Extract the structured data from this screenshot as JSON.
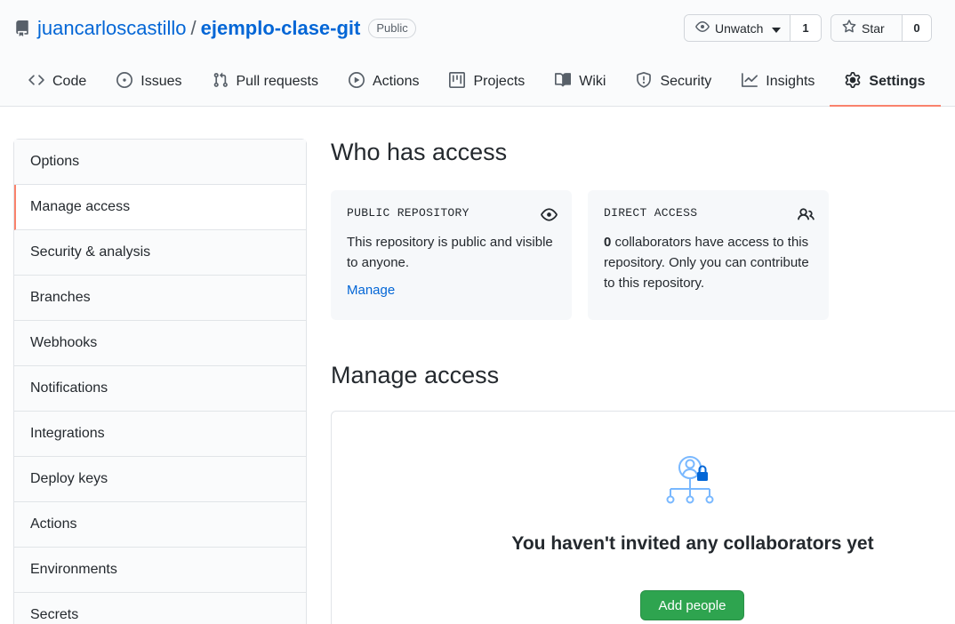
{
  "repo": {
    "owner": "juancarloscastillo",
    "separator": "/",
    "name": "ejemplo-clase-git",
    "visibility": "Public"
  },
  "header_actions": {
    "watch_label": "Unwatch",
    "watch_count": "1",
    "star_label": "Star",
    "star_count": "0"
  },
  "tabs": [
    {
      "label": "Code",
      "icon": "code-icon"
    },
    {
      "label": "Issues",
      "icon": "issue-icon"
    },
    {
      "label": "Pull requests",
      "icon": "pull-request-icon"
    },
    {
      "label": "Actions",
      "icon": "play-icon"
    },
    {
      "label": "Projects",
      "icon": "project-icon"
    },
    {
      "label": "Wiki",
      "icon": "book-icon"
    },
    {
      "label": "Security",
      "icon": "shield-icon"
    },
    {
      "label": "Insights",
      "icon": "graph-icon"
    },
    {
      "label": "Settings",
      "icon": "gear-icon",
      "active": true
    }
  ],
  "sidebar": {
    "items": [
      {
        "label": "Options"
      },
      {
        "label": "Manage access"
      },
      {
        "label": "Security & analysis"
      },
      {
        "label": "Branches"
      },
      {
        "label": "Webhooks"
      },
      {
        "label": "Notifications"
      },
      {
        "label": "Integrations"
      },
      {
        "label": "Deploy keys"
      },
      {
        "label": "Actions"
      },
      {
        "label": "Environments"
      },
      {
        "label": "Secrets"
      }
    ],
    "selected_index": 1
  },
  "main": {
    "who_has_access_title": "Who has access",
    "public_card": {
      "title": "PUBLIC REPOSITORY",
      "text": "This repository is public and visible to anyone.",
      "link": "Manage"
    },
    "direct_card": {
      "title": "DIRECT ACCESS",
      "count": "0",
      "text": " collaborators have access to this repository. Only you can contribute to this repository."
    },
    "manage_access_title": "Manage access",
    "empty_state": "You haven't invited any collaborators yet",
    "add_button": "Add people"
  },
  "colors": {
    "link": "#0366d6",
    "accent": "#f9826c",
    "primary_button": "#2ea44f"
  }
}
